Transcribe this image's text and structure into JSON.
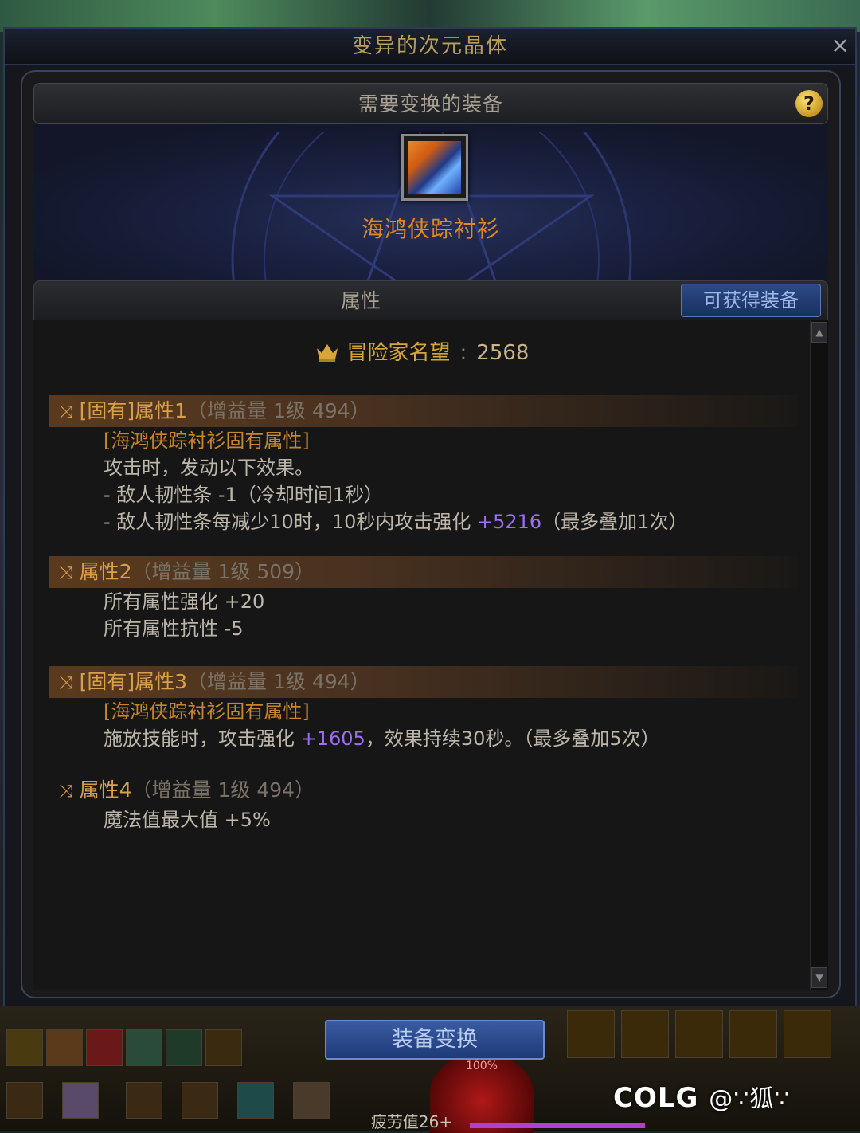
{
  "window": {
    "title": "变异的次元晶体",
    "close_label": "×"
  },
  "equip_section": {
    "header": "需要变换的装备",
    "help_label": "?",
    "item_name": "海鸿侠踪衬衫"
  },
  "attributes": {
    "header": "属性",
    "get_equip_button": "可获得装备",
    "reputation_label": "冒险家名望",
    "reputation_sep": ":",
    "reputation_value": "2568",
    "blocks": [
      {
        "title": "[固有]属性1",
        "gain": "（增益量 1级 494）",
        "lines": [
          {
            "text": "[海鸿侠踪衬衫固有属性]",
            "style": "orange"
          },
          {
            "text": "攻击时，发动以下效果。"
          },
          {
            "text": "- 敌人韧性条 -1（冷却时间1秒）"
          },
          {
            "text": "- 敌人韧性条每减少10时，10秒内攻击强化 ",
            "highlight": "+5216",
            "suffix": "（最多叠加1次）"
          }
        ]
      },
      {
        "title": "属性2",
        "gain": "（增益量 1级 509）",
        "lines": [
          {
            "text": "所有属性强化 +20"
          },
          {
            "text": "所有属性抗性 -5"
          }
        ]
      },
      {
        "title": "[固有]属性3",
        "gain": "（增益量 1级 494）",
        "lines": [
          {
            "text": "[海鸿侠踪衬衫固有属性]",
            "style": "orange"
          },
          {
            "text": "施放技能时，攻击强化 ",
            "highlight": "+1605",
            "suffix": "，效果持续30秒。（最多叠加5次）"
          }
        ]
      },
      {
        "title": "属性4",
        "gain": "（增益量 1级 494）",
        "lines": [
          {
            "text": "魔法值最大值 +5%"
          }
        ]
      }
    ]
  },
  "hud": {
    "convert_button": "装备变换",
    "fatigue": "疲劳值26+",
    "orb_text": "100%",
    "watermark_brand": "COLG",
    "watermark_user": "@∵狐∵"
  },
  "colors": {
    "title_gold": "#b8a05a",
    "item_orange": "#e08a1e",
    "attr_gold": "#d8a04a",
    "highlight_purple": "#9b6ff0",
    "button_blue": "#2c4a86"
  }
}
